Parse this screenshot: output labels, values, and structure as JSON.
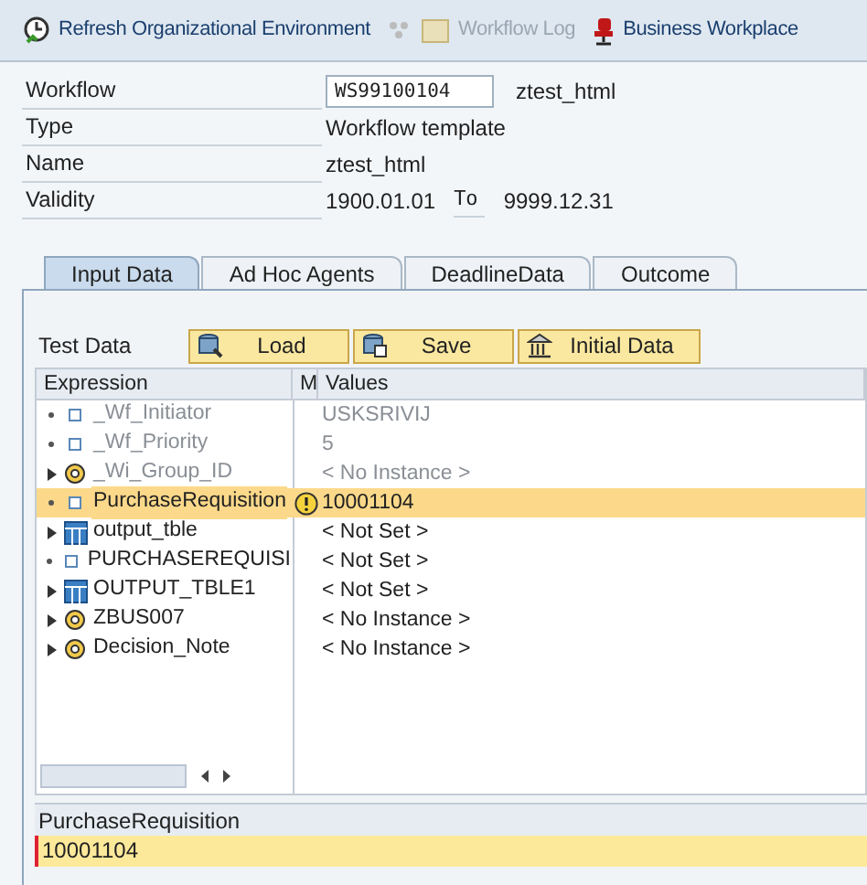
{
  "toolbar": [
    {
      "label": "Refresh Organizational Environment",
      "disabled": false
    },
    {
      "label": "Workflow Log",
      "disabled": true
    },
    {
      "label": "Business Workplace",
      "disabled": false
    }
  ],
  "header": [
    {
      "label": "Workflow",
      "kind": "input",
      "value": "WS99100104",
      "extra": "ztest_html"
    },
    {
      "label": "Type",
      "kind": "text",
      "value": "Workflow template"
    },
    {
      "label": "Name",
      "kind": "text",
      "value": "ztest_html"
    },
    {
      "label": "Validity",
      "kind": "range",
      "value": "1900.01.01",
      "to_label": "To",
      "to_value": "9999.12.31"
    }
  ],
  "tabs": [
    {
      "label": "Input Data",
      "selected": true
    },
    {
      "label": "Ad Hoc Agents",
      "selected": false
    },
    {
      "label": "DeadlineData",
      "selected": false
    },
    {
      "label": "Outcome",
      "selected": false
    }
  ],
  "test_data": {
    "label": "Test Data",
    "buttons": [
      {
        "label": "Load"
      },
      {
        "label": "Save"
      },
      {
        "label": "Initial Data"
      }
    ]
  },
  "tree": {
    "columns": [
      "Expression",
      "M",
      "Values"
    ],
    "rows": [
      {
        "expression": "_Wf_Initiator",
        "value": "USKSRIVIJ",
        "kind": "element",
        "expandable": false,
        "disabled": true,
        "selected": false,
        "warning": false
      },
      {
        "expression": "_Wf_Priority",
        "value": "5",
        "kind": "element",
        "expandable": false,
        "disabled": true,
        "selected": false,
        "warning": false
      },
      {
        "expression": "_Wi_Group_ID",
        "value": "< No Instance >",
        "kind": "object",
        "expandable": true,
        "disabled": true,
        "selected": false,
        "warning": false
      },
      {
        "expression": "PurchaseRequisition",
        "value": "10001104",
        "kind": "element",
        "expandable": false,
        "disabled": false,
        "selected": true,
        "warning": true
      },
      {
        "expression": "output_tble",
        "value": "< Not Set >",
        "kind": "table",
        "expandable": true,
        "disabled": false,
        "selected": false,
        "warning": false
      },
      {
        "expression": "PURCHASEREQUISI",
        "value": "< Not Set >",
        "kind": "element",
        "expandable": false,
        "disabled": false,
        "selected": false,
        "warning": false
      },
      {
        "expression": "OUTPUT_TBLE1",
        "value": "< Not Set >",
        "kind": "table",
        "expandable": true,
        "disabled": false,
        "selected": false,
        "warning": false
      },
      {
        "expression": "ZBUS007",
        "value": "< No Instance >",
        "kind": "object",
        "expandable": true,
        "disabled": false,
        "selected": false,
        "warning": false
      },
      {
        "expression": "Decision_Note",
        "value": "< No Instance >",
        "kind": "object",
        "expandable": true,
        "disabled": false,
        "selected": false,
        "warning": false
      }
    ]
  },
  "detail": {
    "title": "PurchaseRequisition",
    "value": "10001104"
  }
}
